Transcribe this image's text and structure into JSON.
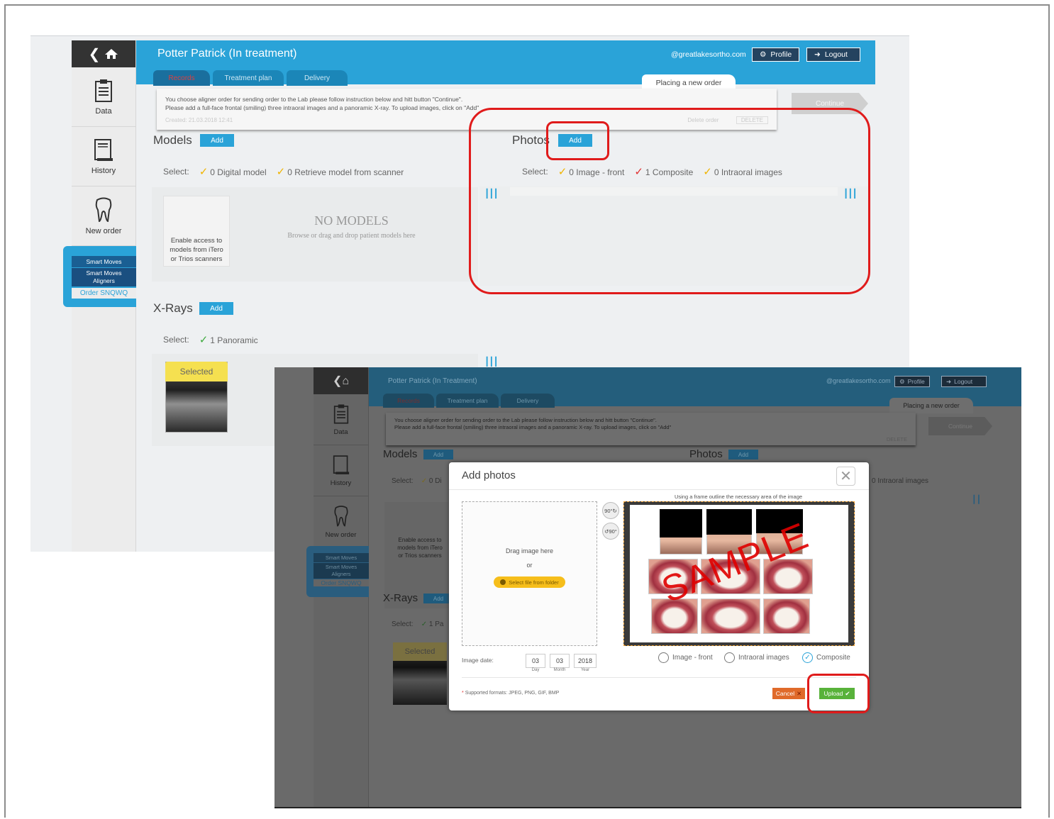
{
  "bg": {
    "patient_title": "Potter Patrick (In treatment)",
    "email": "@greatlakesortho.com",
    "profile_label": "Profile",
    "logout_label": "Logout",
    "tabs": [
      "Records",
      "Treatment plan",
      "Delivery"
    ],
    "placing": "Placing a new order",
    "instruction_line1": "You choose aligner order for sending order to the Lab please follow instruction below and hitt button \"Continue\".",
    "instruction_line2": "Please add a full-face frontal (smiling) three intraoral images and a panoramic X-ray. To upload images, click on \"Add\"",
    "created": "Created: 21.03.2018 12:41",
    "delete_order": "Delete order",
    "delete_btn": "DELETE",
    "continue_label": "Continue",
    "sidebar": {
      "data": "Data",
      "history": "History",
      "new_order": "New order",
      "smart_moves": "Smart Moves",
      "smart_moves_aligners_1": "Smart Moves",
      "smart_moves_aligners_2": "Aligners",
      "order": "Order SNQWQ"
    },
    "models": {
      "title": "Models",
      "add": "Add",
      "select_label": "Select:",
      "opt1": "0 Digital model",
      "opt2": "0 Retrieve model from scanner",
      "tile_text_1": "Enable access to",
      "tile_text_2": "models from iTero",
      "tile_text_3": "or Trios scanners",
      "no_models": "NO MODELS",
      "no_models_sub": "Browse or drag and drop patient models here"
    },
    "photos": {
      "title": "Photos",
      "add": "Add",
      "select_label": "Select:",
      "opt1": "0 Image - front",
      "opt2": "1 Composite",
      "opt3": "0 Intraoral images"
    },
    "xrays": {
      "title": "X-Rays",
      "add": "Add",
      "select_label": "Select:",
      "opt1": "1 Panoramic",
      "selected": "Selected"
    }
  },
  "fg": {
    "patient_title": "Potter Patrick (In Treatment)",
    "email": "@greatlakesortho.com",
    "profile_label": "Profile",
    "logout_label": "Logout",
    "tabs": [
      "Records",
      "Treatment plan",
      "Delivery"
    ],
    "placing": "Placing a new order",
    "instruction_line1": "You choose aligner order for sending order to the Lab please follow instruction below and hitt button \"Continue\".",
    "instruction_line2": "Please add a full-face frontal (smiling) three intraoral images and a panoramic X-ray. To upload images, click on \"Add\"",
    "continue_label": "Continue",
    "delete_btn": "DELETE",
    "sidebar": {
      "data": "Data",
      "history": "History",
      "new_order": "New order",
      "smart_moves": "Smart Moves",
      "smart_moves_aligners_1": "Smart Moves",
      "smart_moves_aligners_2": "Aligners",
      "order": "Order SNQWQ"
    },
    "models_title": "Models",
    "photos_title": "Photos",
    "xrays_title": "X-Rays",
    "add": "Add",
    "select_label": "Select:",
    "models_opt_partial": "0 Di",
    "photos_opt3": "0 Intraoral images",
    "xrays_opt_partial": "1 Pa",
    "tile_text_1": "Enable access to",
    "tile_text_2": "models from iTero",
    "tile_text_3": "or Trios scanners",
    "selected": "Selected"
  },
  "modal": {
    "title": "Add photos",
    "close_glyph": "✕",
    "drag_text": "Drag image here",
    "or": "or",
    "select_file": "Select file from folder",
    "rotate_cw": "90°",
    "rotate_ccw": "90°",
    "frame_hint": "Using a frame outline the necessary area of the image",
    "watermark": "SAMPLE",
    "image_date_label": "Image date:",
    "day": "03",
    "month": "03",
    "year": "2018",
    "day_label": "Day",
    "month_label": "Month",
    "year_label": "Year",
    "radio_image_front": "Image - front",
    "radio_intraoral": "Intraoral images",
    "radio_composite": "Composite",
    "formats": "Supported formats: JPEG, PNG, GIF, BMP",
    "formats_star": "*",
    "cancel": "Cancel",
    "upload": "Upload"
  }
}
